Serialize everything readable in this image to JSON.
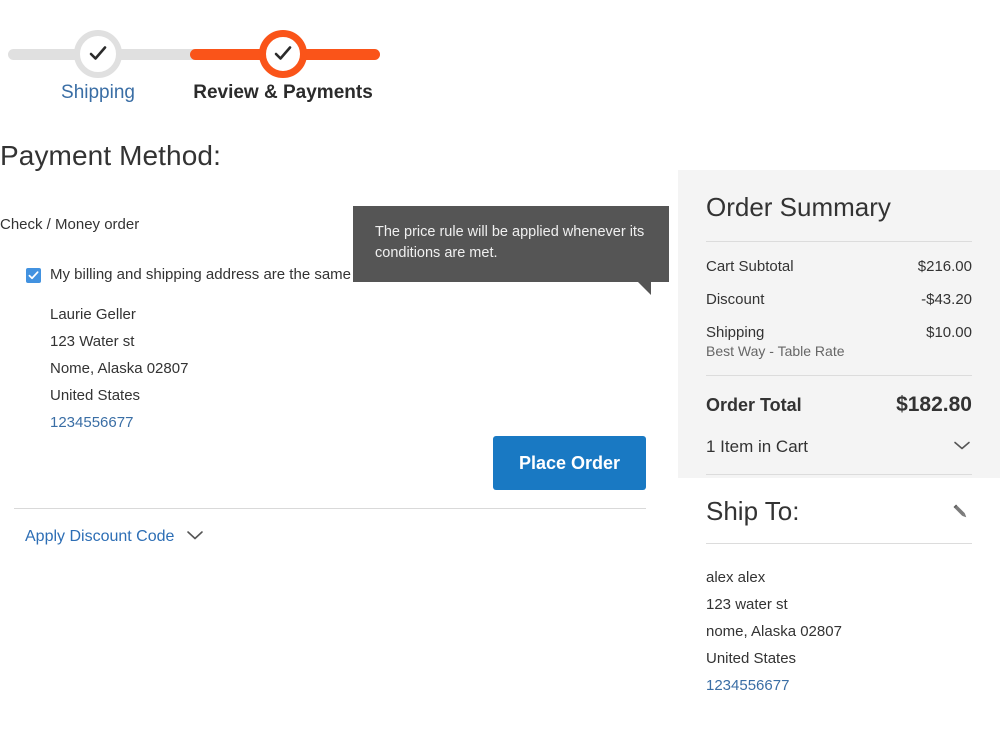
{
  "progress": {
    "steps": [
      {
        "label": "Shipping",
        "state": "complete",
        "icon": "check-icon"
      },
      {
        "label": "Review & Payments",
        "state": "active",
        "icon": "check-icon"
      }
    ],
    "colors": {
      "active": "#fa5419",
      "track": "#e0e0e0",
      "complete_label": "#3a6ea5"
    }
  },
  "payment": {
    "heading": "Payment Method:",
    "method_name": "Check / Money order",
    "billing_same_label": "My billing and shipping address are the same",
    "billing_same_checked": true,
    "billing_address": [
      "Laurie Geller",
      "123 Water st",
      "Nome, Alaska 02807",
      "United States"
    ],
    "billing_phone": "1234556677",
    "place_order_label": "Place Order"
  },
  "tooltip": {
    "text": "The price rule will be applied whenever its conditions are met.",
    "background": "#555555"
  },
  "discount": {
    "label": "Apply Discount Code",
    "icon": "chevron-down-icon"
  },
  "summary": {
    "title": "Order Summary",
    "rows": [
      {
        "label": "Cart Subtotal",
        "value": "$216.00",
        "sub": ""
      },
      {
        "label": "Discount",
        "value": "-$43.20",
        "sub": ""
      },
      {
        "label": "Shipping",
        "value": "$10.00",
        "sub": "Best Way - Table Rate"
      }
    ],
    "total_label": "Order Total",
    "total_value": "$182.80",
    "cart_items_label": "1 Item in Cart",
    "cart_items_icon": "chevron-down-icon"
  },
  "ship_to": {
    "title": "Ship To:",
    "edit_icon": "pencil-icon",
    "address": [
      "alex alex",
      "123 water st",
      "nome, Alaska 02807",
      "United States"
    ],
    "phone": "1234556677"
  }
}
